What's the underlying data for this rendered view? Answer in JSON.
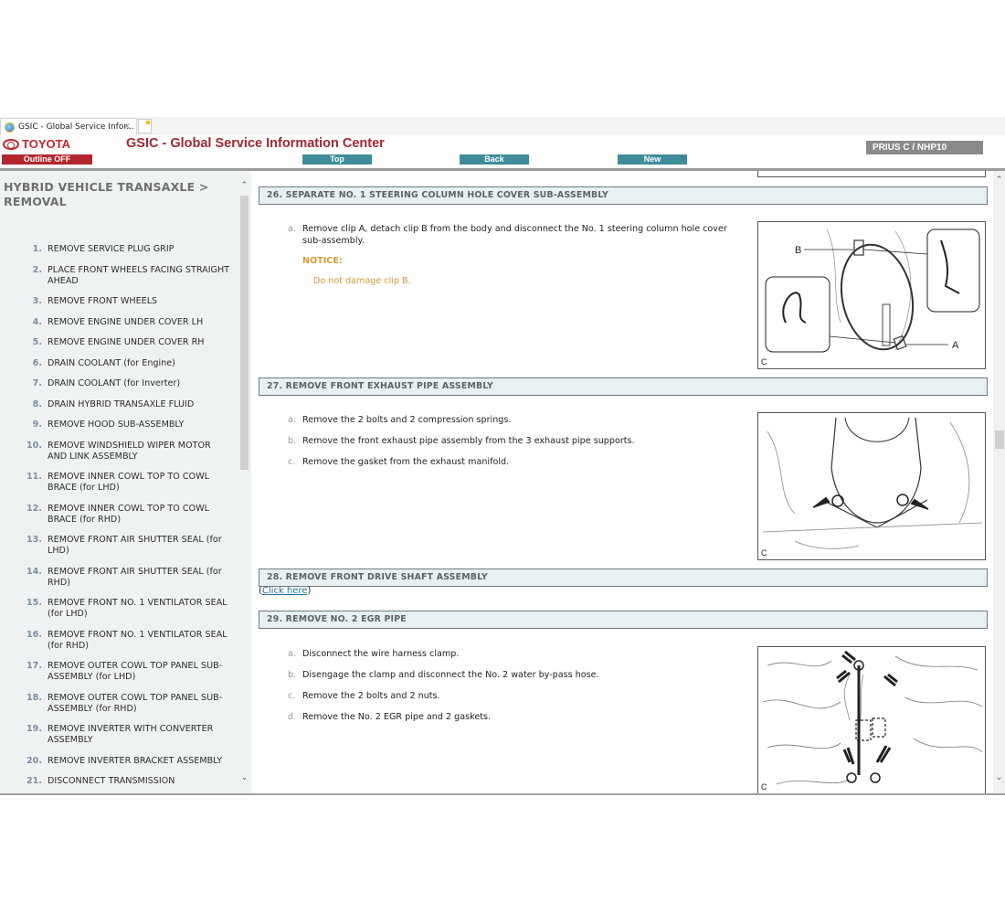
{
  "browser": {
    "tab_title": "GSIC - Global Service Infor...",
    "tab_close": "×"
  },
  "header": {
    "brand": "TOYOTA",
    "title": "GSIC - Global Service Information Center",
    "outline_button": "Outline OFF",
    "nav": {
      "top": "Top",
      "back": "Back",
      "new": "New"
    },
    "model": "PRIUS C / NHP10"
  },
  "colors": {
    "brand_red": "#c0272d",
    "nav_teal": "#3e8c99",
    "notice": "#d49a3a",
    "section_bg": "#e7f0f2"
  },
  "sidebar": {
    "title": "HYBRID VEHICLE TRANSAXLE > REMOVAL",
    "items": [
      {
        "num": "1.",
        "label": "REMOVE SERVICE PLUG GRIP"
      },
      {
        "num": "2.",
        "label": "PLACE FRONT WHEELS FACING STRAIGHT AHEAD"
      },
      {
        "num": "3.",
        "label": "REMOVE FRONT WHEELS"
      },
      {
        "num": "4.",
        "label": "REMOVE ENGINE UNDER COVER LH"
      },
      {
        "num": "5.",
        "label": "REMOVE ENGINE UNDER COVER RH"
      },
      {
        "num": "6.",
        "label": "DRAIN COOLANT (for Engine)"
      },
      {
        "num": "7.",
        "label": "DRAIN COOLANT (for Inverter)"
      },
      {
        "num": "8.",
        "label": "DRAIN HYBRID TRANSAXLE FLUID"
      },
      {
        "num": "9.",
        "label": "REMOVE HOOD SUB-ASSEMBLY"
      },
      {
        "num": "10.",
        "label": "REMOVE WINDSHIELD WIPER MOTOR AND LINK ASSEMBLY"
      },
      {
        "num": "11.",
        "label": "REMOVE INNER COWL TOP TO COWL BRACE (for LHD)"
      },
      {
        "num": "12.",
        "label": "REMOVE INNER COWL TOP TO COWL BRACE (for RHD)"
      },
      {
        "num": "13.",
        "label": "REMOVE FRONT AIR SHUTTER SEAL (for LHD)"
      },
      {
        "num": "14.",
        "label": "REMOVE FRONT AIR SHUTTER SEAL (for RHD)"
      },
      {
        "num": "15.",
        "label": "REMOVE FRONT NO. 1 VENTILATOR SEAL (for LHD)"
      },
      {
        "num": "16.",
        "label": "REMOVE FRONT NO. 1 VENTILATOR SEAL (for RHD)"
      },
      {
        "num": "17.",
        "label": "REMOVE OUTER COWL TOP PANEL SUB-ASSEMBLY (for LHD)"
      },
      {
        "num": "18.",
        "label": "REMOVE OUTER COWL TOP PANEL SUB-ASSEMBLY (for RHD)"
      },
      {
        "num": "19.",
        "label": "REMOVE INVERTER WITH CONVERTER ASSEMBLY"
      },
      {
        "num": "20.",
        "label": "REMOVE INVERTER BRACKET ASSEMBLY"
      },
      {
        "num": "21.",
        "label": "DISCONNECT TRANSMISSION"
      }
    ]
  },
  "main": {
    "sections": [
      {
        "heading": "26. SEPARATE NO. 1 STEERING COLUMN HOLE COVER SUB-ASSEMBLY",
        "steps": [
          {
            "letter": "a.",
            "text": "Remove clip A, detach clip B from the body and disconnect the No. 1 steering column hole cover sub-assembly."
          }
        ],
        "notice_heading": "NOTICE:",
        "notice_text": "Do not damage clip B.",
        "figure": {
          "label": "C",
          "callouts": [
            "A",
            "B"
          ]
        }
      },
      {
        "heading": "27. REMOVE FRONT EXHAUST PIPE ASSEMBLY",
        "steps": [
          {
            "letter": "a.",
            "text": "Remove the 2 bolts and 2 compression springs."
          },
          {
            "letter": "b.",
            "text": "Remove the front exhaust pipe assembly from the 3 exhaust pipe supports."
          },
          {
            "letter": "c.",
            "text": "Remove the gasket from the exhaust manifold."
          }
        ],
        "figure": {
          "label": "C"
        }
      },
      {
        "heading": "28. REMOVE FRONT DRIVE SHAFT ASSEMBLY",
        "link_open": "(",
        "link_text": "Click here",
        "link_close": ")"
      },
      {
        "heading": "29. REMOVE NO. 2 EGR PIPE",
        "steps": [
          {
            "letter": "a.",
            "text": "Disconnect the wire harness clamp."
          },
          {
            "letter": "b.",
            "text": "Disengage the clamp and disconnect the No. 2 water by-pass hose."
          },
          {
            "letter": "c.",
            "text": "Remove the 2 bolts and 2 nuts."
          },
          {
            "letter": "d.",
            "text": "Remove the No. 2 EGR pipe and 2 gaskets."
          }
        ],
        "figure": {
          "label": "C"
        }
      }
    ]
  },
  "scrollbars": {
    "up": "⌃",
    "down": "⌄"
  }
}
